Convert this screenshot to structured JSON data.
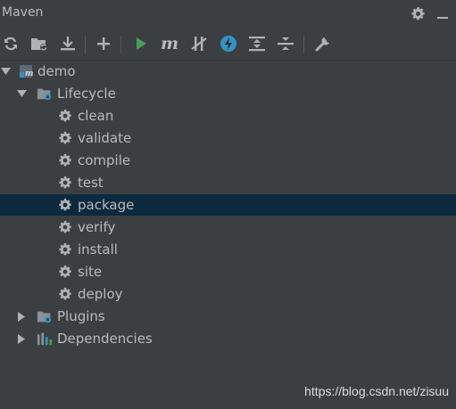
{
  "panel": {
    "title": "Maven"
  },
  "header_icons": [
    "gear-icon",
    "hide-panel-icon"
  ],
  "toolbar": {
    "buttons": [
      {
        "name": "reload-icon",
        "tooltip": ""
      },
      {
        "name": "folder-refresh-icon",
        "tooltip": ""
      },
      {
        "name": "download-icon",
        "tooltip": ""
      },
      {
        "name": "add-icon",
        "tooltip": ""
      },
      {
        "name": "run-icon",
        "tooltip": ""
      },
      {
        "name": "maven-goal-icon",
        "tooltip": ""
      },
      {
        "name": "skip-tests-icon",
        "tooltip": ""
      },
      {
        "name": "offline-icon",
        "tooltip": ""
      },
      {
        "name": "expand-all-icon",
        "tooltip": ""
      },
      {
        "name": "collapse-all-icon",
        "tooltip": ""
      },
      {
        "name": "settings-wrench-icon",
        "tooltip": ""
      }
    ],
    "maven_glyph": "m"
  },
  "tree": {
    "project": "demo",
    "lifecycle": {
      "label": "Lifecycle",
      "goals": [
        "clean",
        "validate",
        "compile",
        "test",
        "package",
        "verify",
        "install",
        "site",
        "deploy"
      ],
      "selected": "package"
    },
    "plugins": "Plugins",
    "dependencies": "Dependencies"
  },
  "watermark": "https://blog.csdn.net/zisuu",
  "colors": {
    "background": "#3c3f41",
    "selection": "#0d293e",
    "text": "#bbbbbb",
    "run_green": "#499c54",
    "offline_blue": "#3592c4"
  }
}
